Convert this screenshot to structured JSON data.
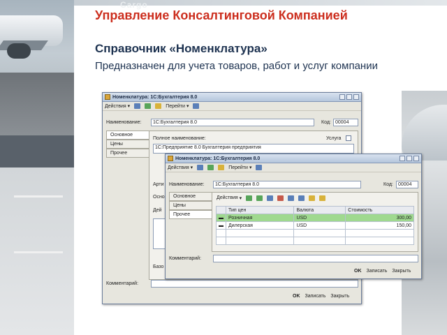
{
  "slide": {
    "title": "Управление Консалтинговой Компанией",
    "subtitle": "Справочник «Номенклатура»",
    "description": "Предназначен для учета товаров, работ и услуг компании",
    "photo_sign": "Cargo",
    "colors": {
      "title": "#cc2e1e",
      "subtitle": "#1d3250",
      "selected_row": "#9fd98f",
      "window_border": "#6a7c9a"
    }
  },
  "window_main": {
    "title": "Номенклатура: 1С:Бухгалтерия 8.0",
    "menu": {
      "actions": "Действия",
      "goto": "Перейти"
    },
    "name_label": "Наименование:",
    "name_value": "1С:Бухгалтерия 8.0",
    "code_label": "Код:",
    "code_value": "00004",
    "tabs": [
      "Основное",
      "Цены",
      "Прочее"
    ],
    "full_name_label": "Полное наименование:",
    "full_name_value": "1С:Предприятие 8.0 Бухгалтерия предприятия",
    "service_label": "Услуга",
    "partial_labels": [
      "Арти",
      "Осно",
      "Дей",
      "Базо"
    ],
    "comment_label": "Комментарий:",
    "footer": {
      "ok": "OK",
      "save": "Записать",
      "close": "Закрыть"
    }
  },
  "window_prices": {
    "title": "Номенклатура: 1С:Бухгалтерия 8.0",
    "menu": {
      "actions": "Действия",
      "goto": "Перейти"
    },
    "name_label": "Наименование:",
    "name_value": "1С:Бухгалтерия 8.0",
    "code_label": "Код:",
    "code_value": "00004",
    "tabs": [
      "Основное",
      "Цены",
      "Прочее"
    ],
    "table_menu": "Действия",
    "columns": [
      "Тип цен",
      "Валюта",
      "Стоимость"
    ],
    "rows": [
      {
        "type": "Розничная",
        "currency": "USD",
        "price": "300,00"
      },
      {
        "type": "Дилерская",
        "currency": "USD",
        "price": "150,00"
      }
    ],
    "comment_label": "Комментарий:",
    "footer": {
      "ok": "OK",
      "save": "Записать",
      "close": "Закрыть"
    }
  }
}
